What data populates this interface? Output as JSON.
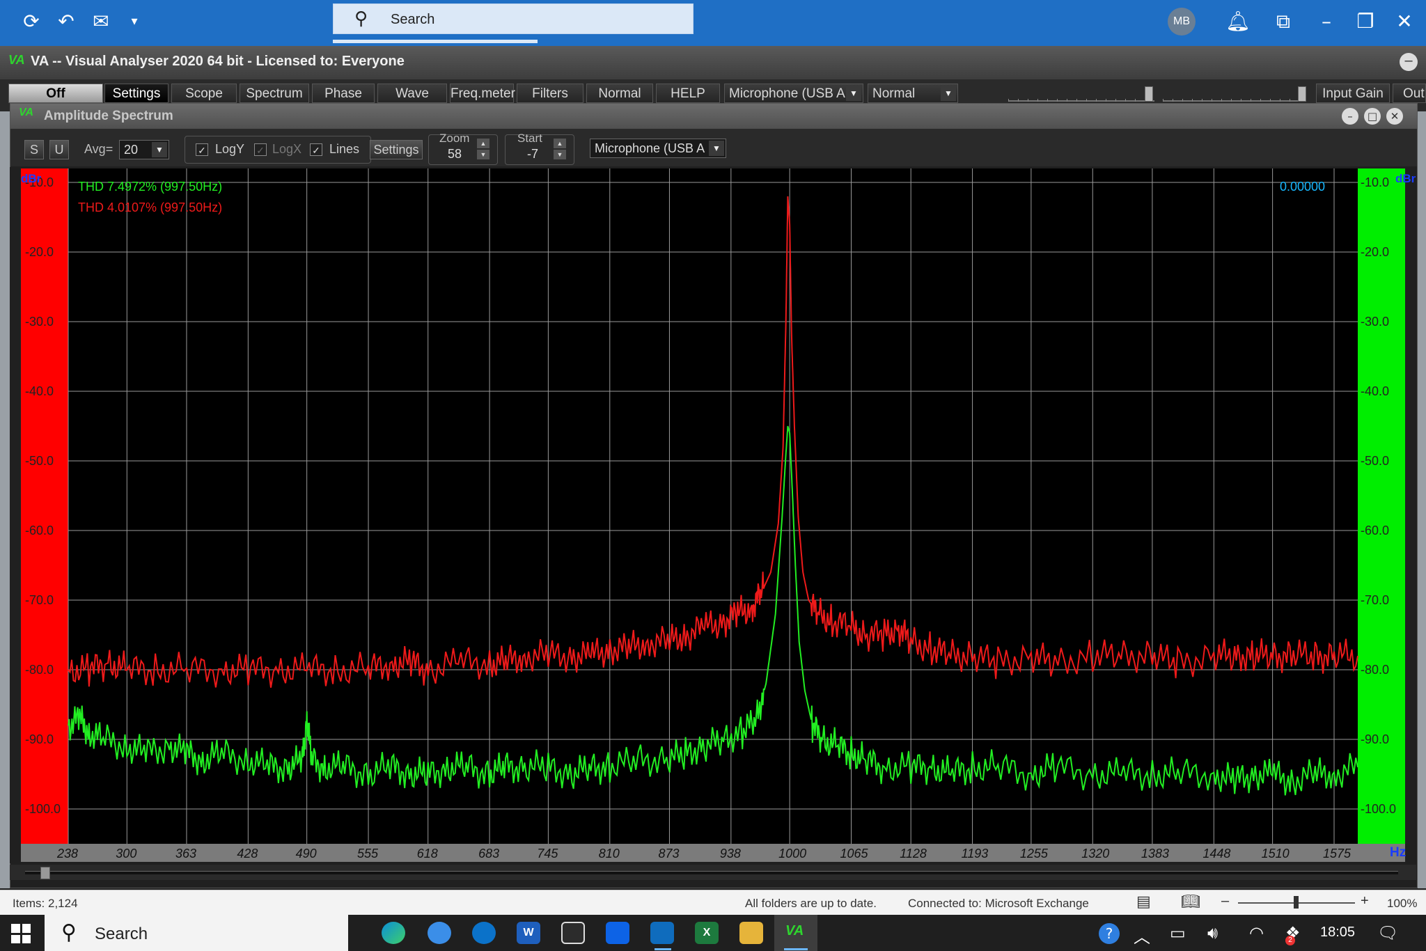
{
  "outlook": {
    "search_placeholder": "Search",
    "avatar_initials": "MB"
  },
  "va": {
    "logo": "VA",
    "window_title": "VA -- Visual Analyser 2020 64 bit - Licensed to: Everyone",
    "tabs": [
      "Off",
      "Settings",
      "Scope",
      "Spectrum",
      "Phase",
      "Wave",
      "Freq.meter",
      "Filters",
      "Normal",
      "HELP"
    ],
    "input_device": "Microphone (USB A",
    "mode": "Normal",
    "input_gain_label": "Input Gain",
    "output_label": "Out"
  },
  "spectrum_window": {
    "title": "Amplitude Spectrum",
    "s_button": "S",
    "u_button": "U",
    "avg_label": "Avg=",
    "avg_value": "20",
    "logy_label": "LogY",
    "logx_label": "LogX",
    "lines_label": "Lines",
    "settings_label": "Settings",
    "zoom_label": "Zoom",
    "zoom_value": "58",
    "start_label": "Start",
    "start_value": "-7",
    "device": "Microphone (USB A"
  },
  "chart_data": {
    "type": "line",
    "ylabel": "dBr",
    "xlabel": "Hz",
    "xlim": [
      238,
      1600
    ],
    "ylim": [
      -105,
      -8
    ],
    "y_ticks": [
      "-10.0",
      "-20.0",
      "-30.0",
      "-40.0",
      "-50.0",
      "-60.0",
      "-70.0",
      "-80.0",
      "-90.0",
      "-100.0"
    ],
    "x_ticks": [
      "238",
      "300",
      "363",
      "428",
      "490",
      "555",
      "618",
      "683",
      "745",
      "810",
      "873",
      "938",
      "1000",
      "1065",
      "1128",
      "1193",
      "1255",
      "1320",
      "1383",
      "1448",
      "1510",
      "1575"
    ],
    "readout": "0.00000",
    "grid": true,
    "series": [
      {
        "name": "THD 7.4972% (997.50Hz)",
        "color": "#22ee22",
        "x": [
          238,
          250,
          260,
          275,
          300,
          320,
          345,
          363,
          380,
          400,
          428,
          450,
          470,
          485,
          490,
          495,
          510,
          530,
          555,
          580,
          600,
          618,
          640,
          660,
          683,
          700,
          720,
          745,
          770,
          790,
          810,
          840,
          870,
          890,
          910,
          930,
          950,
          965,
          975,
          985,
          992,
          996,
          998,
          1000,
          1003,
          1006,
          1010,
          1016,
          1024,
          1035,
          1050,
          1065,
          1080,
          1100,
          1128,
          1150,
          1170,
          1193,
          1220,
          1255,
          1280,
          1320,
          1350,
          1383,
          1410,
          1448,
          1470,
          1490,
          1510,
          1530,
          1555,
          1575,
          1600
        ],
        "y": [
          -88,
          -87,
          -89,
          -90,
          -91,
          -92,
          -91,
          -92,
          -93,
          -92,
          -93,
          -94,
          -94,
          -93,
          -87,
          -93,
          -94,
          -94,
          -95,
          -94,
          -95,
          -95,
          -94,
          -94,
          -95,
          -94,
          -94,
          -94,
          -95,
          -94,
          -94,
          -93,
          -93,
          -92,
          -91,
          -90,
          -89,
          -87,
          -82,
          -72,
          -58,
          -49,
          -45,
          -46,
          -55,
          -65,
          -76,
          -83,
          -88,
          -90,
          -91,
          -92,
          -93,
          -94,
          -94,
          -94,
          -95,
          -94,
          -94,
          -95,
          -94,
          -95,
          -95,
          -95,
          -95,
          -95,
          -96,
          -95,
          -95,
          -96,
          -95,
          -95,
          -94
        ]
      },
      {
        "name": "THD 4.0107% (997.50Hz)",
        "color": "#ee1a1a",
        "x": [
          238,
          260,
          280,
          300,
          330,
          363,
          400,
          428,
          460,
          490,
          520,
          555,
          580,
          600,
          618,
          650,
          683,
          700,
          720,
          745,
          770,
          790,
          810,
          830,
          850,
          873,
          890,
          910,
          930,
          945,
          960,
          970,
          980,
          988,
          993,
          996,
          998,
          1000,
          1002,
          1005,
          1009,
          1014,
          1020,
          1030,
          1045,
          1065,
          1080,
          1100,
          1115,
          1128,
          1150,
          1170,
          1193,
          1220,
          1255,
          1280,
          1320,
          1350,
          1383,
          1410,
          1448,
          1470,
          1490,
          1510,
          1530,
          1555,
          1575,
          1600
        ],
        "y": [
          -80,
          -80,
          -79,
          -80,
          -80,
          -80,
          -80,
          -80,
          -80,
          -80,
          -80,
          -80,
          -79,
          -79,
          -80,
          -79,
          -79,
          -79,
          -78,
          -78,
          -78,
          -78,
          -77,
          -77,
          -76,
          -76,
          -75,
          -74,
          -73,
          -72,
          -71,
          -69,
          -66,
          -59,
          -48,
          -30,
          -12,
          -16,
          -32,
          -45,
          -58,
          -66,
          -70,
          -72,
          -73,
          -74,
          -75,
          -75,
          -74,
          -76,
          -77,
          -78,
          -78,
          -79,
          -78,
          -79,
          -78,
          -78,
          -78,
          -79,
          -78,
          -78,
          -78,
          -78,
          -78,
          -78,
          -78,
          -78
        ]
      }
    ]
  },
  "status": {
    "items": "Items: 2,124",
    "sync": "All folders are up to date.",
    "connection": "Connected to: Microsoft Exchange",
    "zoom": "100%"
  },
  "taskbar": {
    "search_label": "Search",
    "clock": "18:05",
    "va_label": "VA",
    "word_label": "W",
    "excel_label": "X",
    "badge": "2"
  }
}
